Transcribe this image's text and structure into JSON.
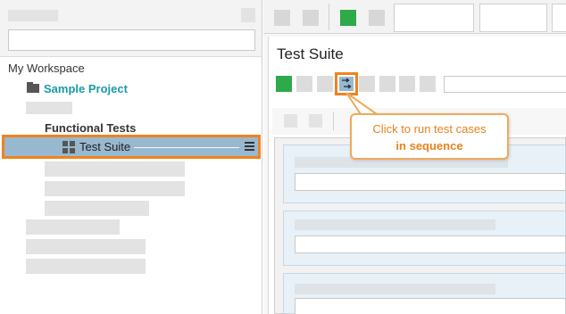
{
  "sidebar": {
    "workspace_label": "My Workspace",
    "project_label": "Sample Project",
    "functional_tests_label": "Functional Tests",
    "test_suite_label": "Test Suite"
  },
  "main": {
    "title": "Test Suite"
  },
  "callout": {
    "line1": "Click to run test cases",
    "line2": "in sequence"
  },
  "colors": {
    "highlight": "#f0821e",
    "run_button": "#2eaa4a",
    "project_text": "#1a9aa8",
    "selected_row": "#98b8d0"
  },
  "icons": [
    "folder-icon",
    "test-suite-icon",
    "hamburger-menu-icon",
    "run-in-sequence-icon",
    "run-icon"
  ]
}
